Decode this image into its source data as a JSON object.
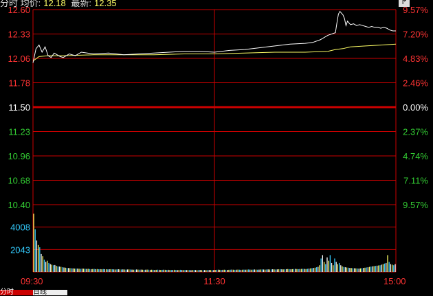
{
  "header": {
    "avg_label": "分时 均价:",
    "avg_value": "12.18",
    "last_label": "最新:",
    "last_value": "12.35"
  },
  "corner_icon": "expand-arrow-icon",
  "bottom_tabs": [
    "分时",
    "日线"
  ],
  "colors": {
    "grid": "#cc0000",
    "up": "#ff3333",
    "down": "#33cc33",
    "price_line": "#ffffff",
    "avg_line": "#ffff66",
    "volume_axis": "#33ccff",
    "time_axis": "#ff3333"
  },
  "chart_data": {
    "type": "line",
    "title": "",
    "prev_close": 11.5,
    "price_axis": {
      "left_ticks": [
        "12.60",
        "12.33",
        "12.06",
        "11.78",
        "11.50",
        "11.23",
        "10.96",
        "10.68",
        "10.40"
      ],
      "right_ticks": [
        "9.57%",
        "7.20%",
        "4.83%",
        "2.46%",
        "0.00%",
        "2.37%",
        "4.74%",
        "7.11%",
        "9.57%"
      ],
      "ylim": [
        10.4,
        12.6
      ]
    },
    "time_axis": {
      "ticks": [
        "09:30",
        "11:30",
        "15:00"
      ],
      "xlim": [
        0,
        240
      ]
    },
    "volume_axis": {
      "ticks": [
        "4008",
        "2043"
      ],
      "ylim": [
        0,
        6000
      ]
    },
    "series": [
      {
        "key": "price",
        "x": [
          0,
          2,
          4,
          6,
          8,
          10,
          12,
          14,
          16,
          18,
          20,
          24,
          28,
          32,
          40,
          50,
          60,
          70,
          80,
          90,
          100,
          110,
          120,
          130,
          140,
          150,
          160,
          170,
          180,
          185,
          190,
          195,
          200,
          201,
          202,
          203,
          204,
          205,
          206,
          207,
          208,
          209,
          210,
          212,
          214,
          216,
          218,
          220,
          222,
          224,
          226,
          228,
          230,
          232,
          234,
          236,
          238,
          240
        ],
        "y": [
          12.0,
          12.16,
          12.2,
          12.12,
          12.18,
          12.08,
          12.06,
          12.11,
          12.09,
          12.07,
          12.06,
          12.1,
          12.08,
          12.12,
          12.1,
          12.11,
          12.09,
          12.1,
          12.11,
          12.12,
          12.13,
          12.13,
          12.12,
          12.14,
          12.15,
          12.17,
          12.19,
          12.21,
          12.22,
          12.23,
          12.26,
          12.31,
          12.34,
          12.45,
          12.55,
          12.58,
          12.56,
          12.54,
          12.5,
          12.42,
          12.47,
          12.45,
          12.43,
          12.44,
          12.42,
          12.43,
          12.42,
          12.41,
          12.4,
          12.41,
          12.4,
          12.4,
          12.39,
          12.4,
          12.39,
          12.37,
          12.36,
          12.36
        ]
      },
      {
        "key": "avg",
        "x": [
          0,
          4,
          10,
          20,
          40,
          60,
          80,
          100,
          120,
          140,
          160,
          180,
          195,
          200,
          205,
          210,
          220,
          230,
          240
        ],
        "y": [
          12.02,
          12.07,
          12.08,
          12.08,
          12.09,
          12.09,
          12.09,
          12.1,
          12.1,
          12.11,
          12.12,
          12.12,
          12.13,
          12.15,
          12.16,
          12.18,
          12.19,
          12.2,
          12.21
        ]
      }
    ],
    "volume": [
      5200,
      3800,
      2800,
      2400,
      2200,
      1600,
      1400,
      1100,
      900,
      1000,
      800,
      700,
      650,
      600,
      620,
      540,
      500,
      480,
      460,
      420,
      400,
      380,
      360,
      350,
      340,
      330,
      320,
      300,
      310,
      300,
      290,
      280,
      300,
      290,
      280,
      270,
      280,
      260,
      250,
      260,
      270,
      250,
      260,
      240,
      250,
      240,
      260,
      250,
      240,
      230,
      240,
      250,
      240,
      230,
      220,
      230,
      240,
      230,
      220,
      230,
      220,
      210,
      220,
      230,
      220,
      210,
      200,
      210,
      220,
      210,
      200,
      210,
      200,
      190,
      200,
      210,
      200,
      190,
      200,
      190,
      180,
      190,
      200,
      190,
      180,
      190,
      200,
      190,
      180,
      190,
      180,
      170,
      180,
      190,
      180,
      170,
      180,
      190,
      180,
      170,
      180,
      170,
      180,
      170,
      160,
      170,
      180,
      170,
      160,
      170,
      180,
      170,
      160,
      170,
      160,
      170,
      180,
      170,
      160,
      170,
      180,
      190,
      200,
      190,
      180,
      190,
      200,
      190,
      180,
      190,
      200,
      210,
      200,
      190,
      200,
      210,
      200,
      190,
      200,
      210,
      200,
      210,
      220,
      210,
      200,
      210,
      220,
      210,
      200,
      210,
      220,
      230,
      220,
      210,
      220,
      230,
      220,
      230,
      240,
      230,
      220,
      230,
      240,
      250,
      240,
      230,
      240,
      250,
      260,
      250,
      240,
      250,
      260,
      270,
      260,
      250,
      260,
      270,
      280,
      270,
      260,
      280,
      300,
      320,
      340,
      360,
      380,
      420,
      460,
      600,
      1200,
      1500,
      900,
      700,
      1300,
      1000,
      1500,
      800,
      600,
      1200,
      900,
      700,
      800,
      600,
      500,
      450,
      420,
      400,
      380,
      360,
      350,
      340,
      330,
      320,
      310,
      300,
      320,
      340,
      360,
      380,
      400,
      420,
      450,
      480,
      500,
      520,
      540,
      560,
      580,
      600,
      650,
      700,
      750,
      800,
      1500,
      900,
      700,
      650,
      600,
      700
    ]
  }
}
